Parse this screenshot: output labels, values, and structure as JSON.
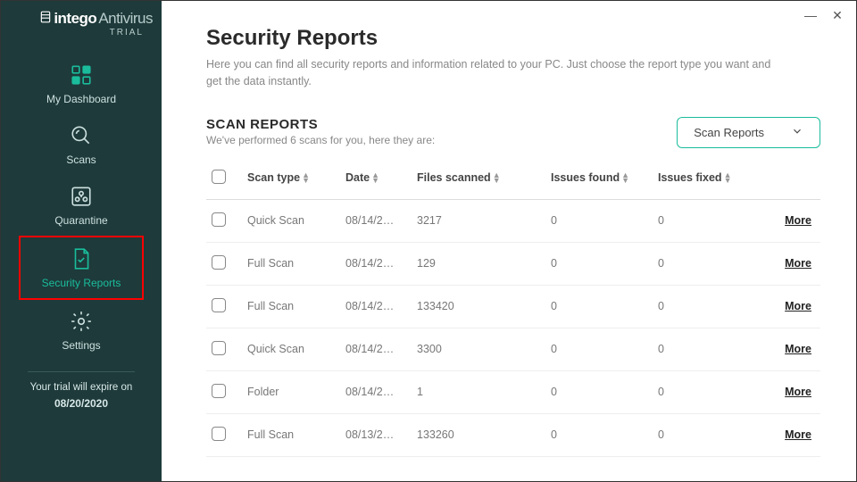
{
  "logo": {
    "part1": "intego",
    "part2": "Antivirus",
    "trial": "TRIAL"
  },
  "nav": {
    "dashboard": "My Dashboard",
    "scans": "Scans",
    "quarantine": "Quarantine",
    "security_reports": "Security Reports",
    "settings": "Settings"
  },
  "trial": {
    "line1": "Your trial will expire on",
    "date": "08/20/2020"
  },
  "page": {
    "title": "Security Reports",
    "subtitle": "Here you can find all security reports and information related to your PC. Just choose the report type you want and get the data instantly."
  },
  "section": {
    "title": "SCAN REPORTS",
    "subtitle": "We've performed 6 scans for you, here they are:"
  },
  "dropdown": {
    "selected": "Scan Reports"
  },
  "columns": {
    "scan_type": "Scan type",
    "date": "Date",
    "files_scanned": "Files scanned",
    "issues_found": "Issues found",
    "issues_fixed": "Issues fixed"
  },
  "more_label": "More",
  "rows": [
    {
      "type": "Quick Scan",
      "date": "08/14/2…",
      "files": "3217",
      "found": "0",
      "fixed": "0"
    },
    {
      "type": "Full Scan",
      "date": "08/14/2…",
      "files": "129",
      "found": "0",
      "fixed": "0"
    },
    {
      "type": "Full Scan",
      "date": "08/14/2…",
      "files": "133420",
      "found": "0",
      "fixed": "0"
    },
    {
      "type": "Quick Scan",
      "date": "08/14/2…",
      "files": "3300",
      "found": "0",
      "fixed": "0"
    },
    {
      "type": "Folder",
      "date": "08/14/2…",
      "files": "1",
      "found": "0",
      "fixed": "0"
    },
    {
      "type": "Full Scan",
      "date": "08/13/2…",
      "files": "133260",
      "found": "0",
      "fixed": "0"
    }
  ]
}
